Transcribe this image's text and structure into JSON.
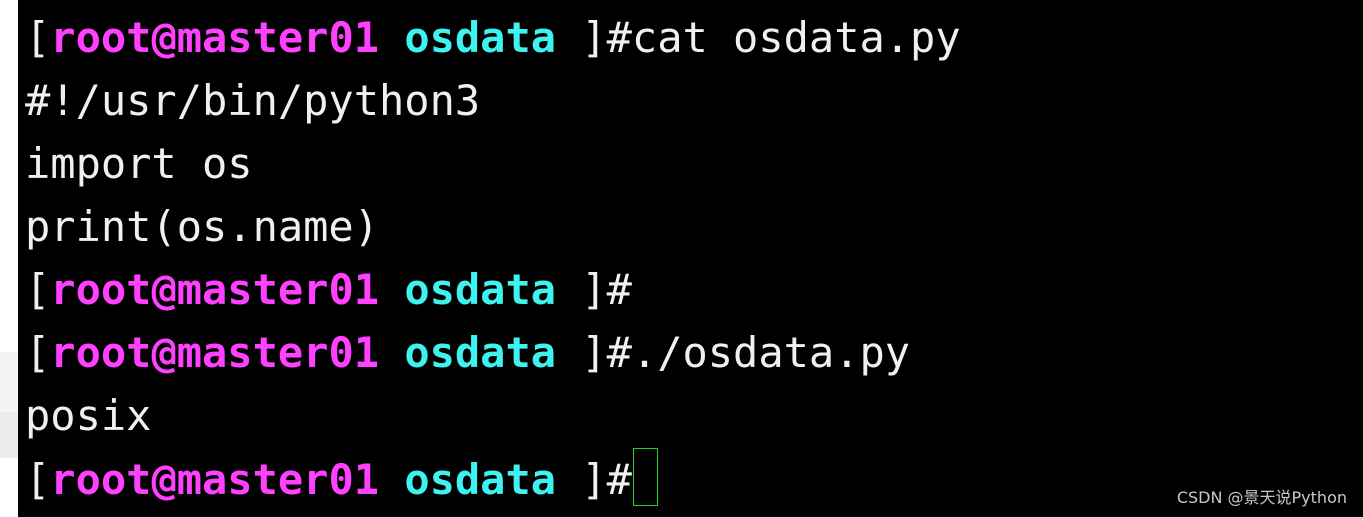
{
  "prompt": {
    "open_bracket": "[",
    "user_host": "root@master01",
    "cwd": "osdata",
    "close": " ]#"
  },
  "lines": [
    {
      "type": "prompt",
      "command": "cat osdata.py"
    },
    {
      "type": "output",
      "text": "#!/usr/bin/python3"
    },
    {
      "type": "output",
      "text": "import os"
    },
    {
      "type": "output",
      "text": "print(os.name)"
    },
    {
      "type": "prompt",
      "command": ""
    },
    {
      "type": "prompt",
      "command": "./osdata.py"
    },
    {
      "type": "output",
      "text": "posix"
    },
    {
      "type": "prompt",
      "command": ""
    }
  ],
  "watermark": "CSDN @景天说Python",
  "colors": {
    "background": "#000000",
    "text": "#f0f0f0",
    "user_host": "#ff40ff",
    "cwd": "#3ef2ef",
    "cursor_border": "#20d020"
  }
}
